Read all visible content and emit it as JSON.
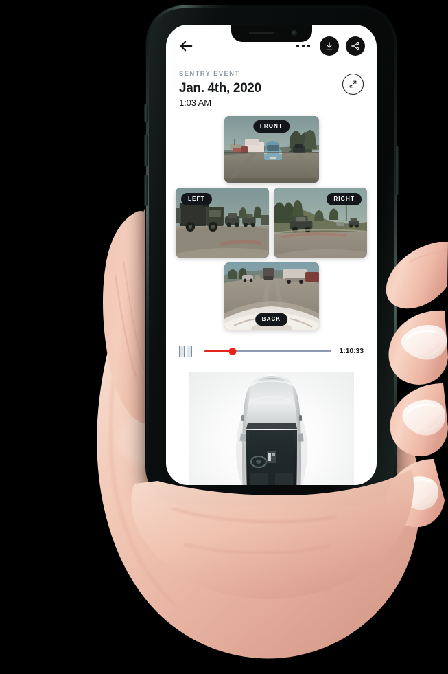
{
  "app": {
    "topbar": {
      "back_icon": "arrow-left-icon",
      "more_icon": "more-options-icon",
      "download_icon": "download-icon",
      "share_icon": "share-icon"
    },
    "header": {
      "eyebrow": "SENTRY EVENT",
      "date": "Jan. 4th, 2020",
      "time": "1:03 AM",
      "expand_icon": "expand-fullscreen-icon"
    },
    "cameras": [
      {
        "id": "front",
        "label": "FRONT",
        "label_pos": "top-center"
      },
      {
        "id": "left",
        "label": "LEFT",
        "label_pos": "top-left"
      },
      {
        "id": "right",
        "label": "RIGHT",
        "label_pos": "top-right"
      },
      {
        "id": "back",
        "label": "BACK",
        "label_pos": "bottom-center"
      }
    ],
    "player": {
      "state_icon": "pause-icon",
      "progress_percent": 22,
      "duration": "1:10:33",
      "progress_color": "#e7231d",
      "track_color": "#8d9bb0"
    },
    "vehicle": {
      "view_icon": "car-top-view-icon"
    }
  },
  "device": {
    "frame_color": "#2c3b38",
    "screen_background": "#ffffff",
    "notch_icons": [
      "earpiece-speaker",
      "front-camera"
    ],
    "side_buttons": [
      "mute-switch",
      "volume-up-button",
      "volume-down-button",
      "power-button"
    ]
  },
  "colors": {
    "accent_red": "#e7231d",
    "text_primary": "#15181a",
    "text_muted": "#8a98a3",
    "pill_background": "#13161a"
  }
}
